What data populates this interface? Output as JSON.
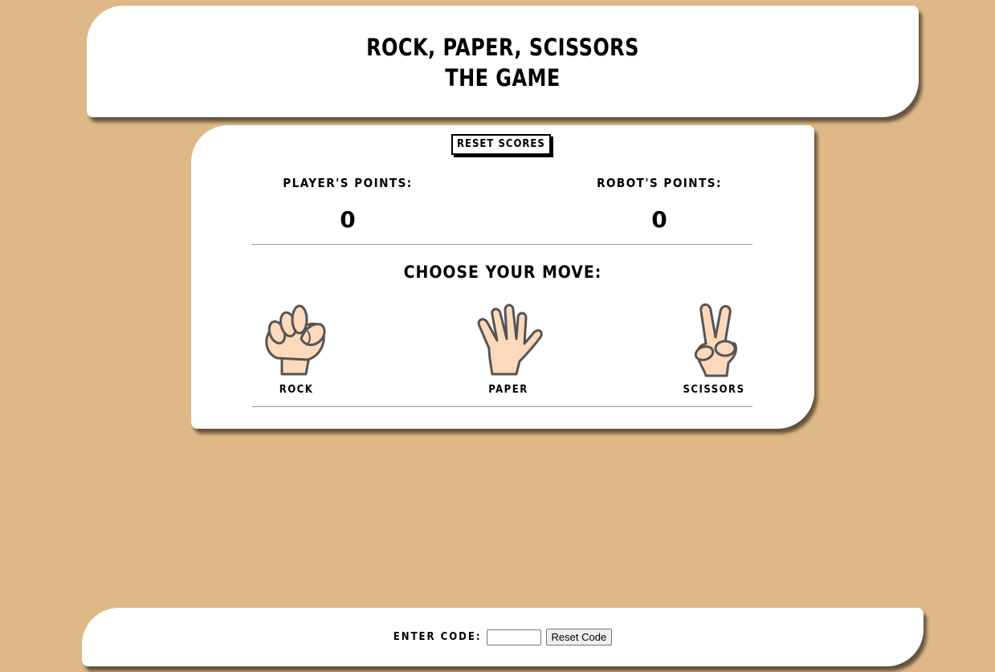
{
  "header": {
    "title_line1": "ROCK, PAPER, SCISSORS",
    "title_line2": "THE GAME"
  },
  "game": {
    "reset_label": "RESET SCORES",
    "player_label": "PLAYER'S POINTS:",
    "player_score": "0",
    "robot_label": "ROBOT'S POINTS:",
    "robot_score": "0",
    "choose_label": "CHOOSE YOUR MOVE:",
    "moves": [
      {
        "label": "ROCK",
        "icon": "rock-hand-icon"
      },
      {
        "label": "PAPER",
        "icon": "paper-hand-icon"
      },
      {
        "label": "SCISSORS",
        "icon": "scissors-hand-icon"
      }
    ]
  },
  "footer": {
    "code_label": "ENTER CODE:",
    "code_value": "",
    "reset_code_label": "Reset Code"
  },
  "colors": {
    "background": "#deb887",
    "panel": "#ffffff",
    "skin": "#fdd9bc",
    "outline": "#555555"
  }
}
